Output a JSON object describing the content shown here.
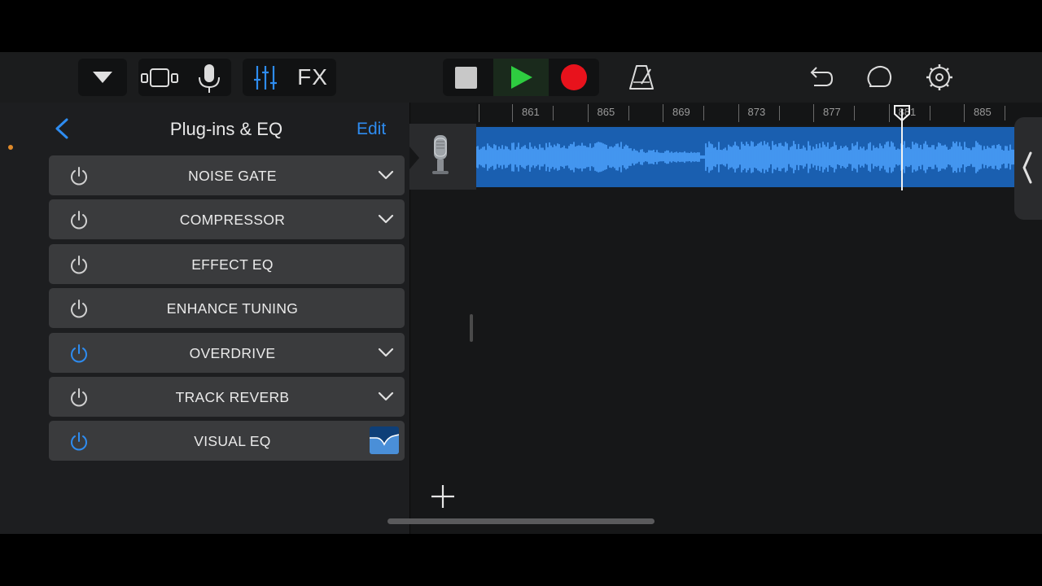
{
  "toolbar": {
    "icons": [
      "dropdown-triangle-icon",
      "track-view-icon",
      "microphone-icon",
      "mixer-icon",
      "stop-icon",
      "play-icon",
      "record-icon",
      "metronome-icon",
      "undo-icon",
      "loop-icon",
      "settings-icon"
    ],
    "fx_label": "FX",
    "colors": {
      "play": "#2ecc40",
      "record": "#e8121c",
      "accent": "#2e8cf0"
    }
  },
  "plugins_panel": {
    "title": "Plug-ins & EQ",
    "edit_label": "Edit",
    "items": [
      {
        "label": "NOISE GATE",
        "power": "off",
        "expandable": true
      },
      {
        "label": "COMPRESSOR",
        "power": "off",
        "expandable": true
      },
      {
        "label": "EFFECT EQ",
        "power": "off",
        "expandable": false
      },
      {
        "label": "ENHANCE TUNING",
        "power": "off",
        "expandable": false
      },
      {
        "label": "OVERDRIVE",
        "power": "on",
        "expandable": true
      },
      {
        "label": "TRACK REVERB",
        "power": "off",
        "expandable": true
      },
      {
        "label": "VISUAL EQ",
        "power": "on",
        "expandable": false,
        "eq_thumbnail": true
      }
    ]
  },
  "ruler": {
    "labels": [
      "861",
      "865",
      "869",
      "873",
      "877",
      "881",
      "885"
    ]
  },
  "track": {
    "instrument_icon": "condenser-microphone-icon",
    "region_color": "#1a5fb0",
    "waveform_color": "#4ea3ff"
  }
}
